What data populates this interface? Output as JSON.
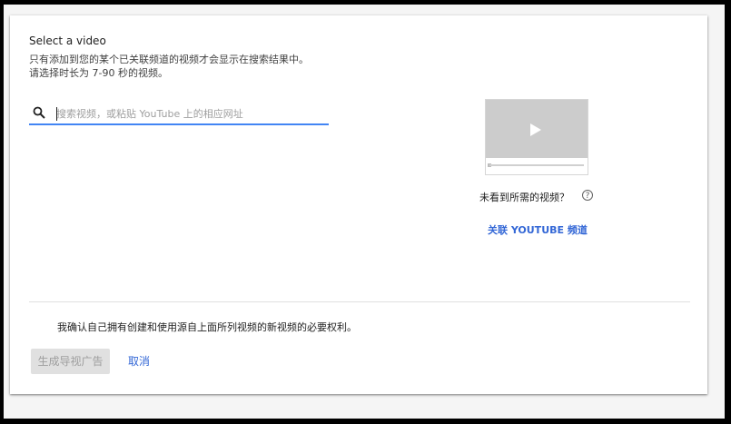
{
  "dialog": {
    "title": "Select a video",
    "subtitle_line1": "只有添加到您的某个已关联频道的视频才会显示在搜索结果中。",
    "subtitle_line2": "请选择时长为 7-90 秒的视频。"
  },
  "search": {
    "placeholder": "搜索视频，或粘贴 YouTube 上的相应网址",
    "value": "",
    "icon": "search-icon",
    "accent_color": "#4285f4"
  },
  "preview": {
    "icon": "play-icon",
    "not_found_text": "未看到所需的视频？",
    "help_icon": "question-circle-icon",
    "help_glyph": "?",
    "link_channel_label": "关联 YOUTUBE 频道",
    "link_color": "#3367d6"
  },
  "footer": {
    "confirm_text": "我确认自己拥有创建和使用源自上面所列视频的新视频的必要权利。",
    "generate_label": "生成导视广告",
    "generate_disabled": true,
    "cancel_label": "取消"
  }
}
